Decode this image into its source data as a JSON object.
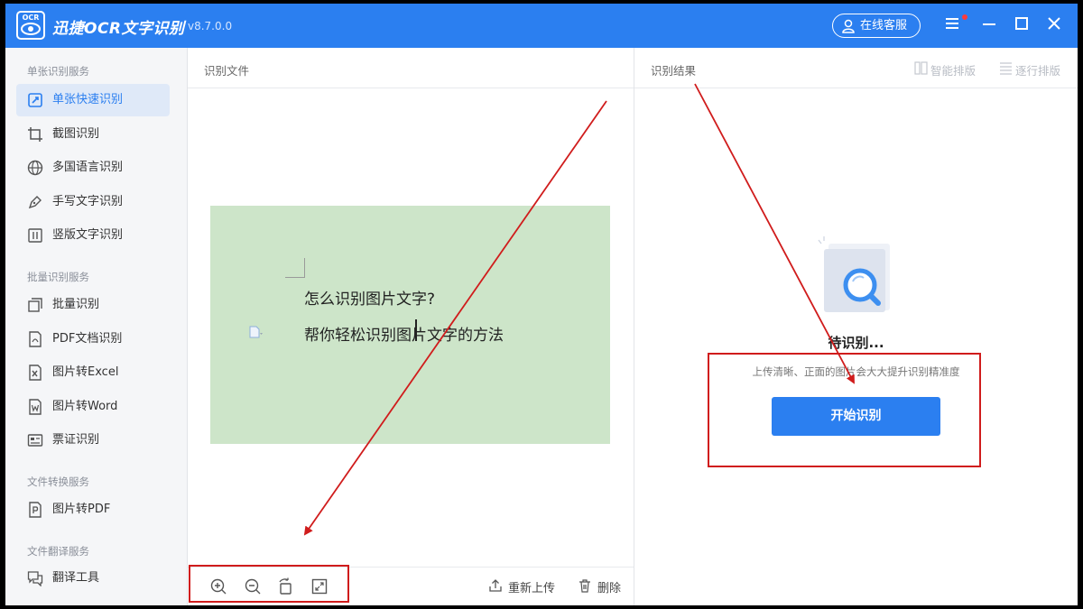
{
  "app": {
    "logo_text": "OCR",
    "name": "迅捷OCR文字识别",
    "version": "v8.7.0.0",
    "service_label": "在线客服"
  },
  "sidebar": {
    "sections": [
      {
        "title": "单张识别服务",
        "items": [
          {
            "label": "单张快速识别",
            "icon": "scan-icon",
            "active": true
          },
          {
            "label": "截图识别",
            "icon": "crop-icon"
          },
          {
            "label": "多国语言识别",
            "icon": "globe-icon"
          },
          {
            "label": "手写文字识别",
            "icon": "pen-icon"
          },
          {
            "label": "竖版文字识别",
            "icon": "vertical-text-icon"
          }
        ]
      },
      {
        "title": "批量识别服务",
        "items": [
          {
            "label": "批量识别",
            "icon": "batch-icon"
          },
          {
            "label": "PDF文档识别",
            "icon": "pdf-icon"
          },
          {
            "label": "图片转Excel",
            "icon": "excel-icon"
          },
          {
            "label": "图片转Word",
            "icon": "word-icon"
          },
          {
            "label": "票证识别",
            "icon": "ticket-icon"
          }
        ]
      },
      {
        "title": "文件转换服务",
        "items": [
          {
            "label": "图片转PDF",
            "icon": "pdf-convert-icon"
          }
        ]
      },
      {
        "title": "文件翻译服务",
        "items": [
          {
            "label": "翻译工具",
            "icon": "translate-icon"
          }
        ]
      }
    ]
  },
  "left_panel": {
    "title": "识别文件",
    "preview": {
      "line1": "怎么识别图片文字?",
      "line2": "帮你轻松识别图片文字的方法"
    },
    "toolbar": {
      "reupload_label": "重新上传",
      "delete_label": "删除"
    }
  },
  "right_panel": {
    "title": "识别结果",
    "smart_layout_label": "智能排版",
    "line_layout_label": "逐行排版",
    "pending_label": "待识别...",
    "hint": "上传清晰、正面的图片会大大提升识别精准度",
    "start_label": "开始识别"
  },
  "colors": {
    "accent": "#2b7ff0",
    "preview_bg": "#cde5c9",
    "annotation": "#d01c1c"
  }
}
